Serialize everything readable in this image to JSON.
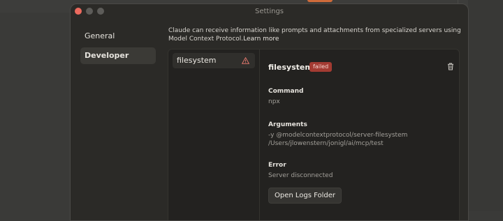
{
  "window": {
    "title": "Settings",
    "controls": [
      "close",
      "minimize",
      "maximize"
    ]
  },
  "sidebar": {
    "items": [
      {
        "label": "General",
        "active": false
      },
      {
        "label": "Developer",
        "active": true
      }
    ]
  },
  "description": {
    "text": "Claude can receive information like prompts and attachments from specialized servers using Model Context Protocol.",
    "link": "Learn more"
  },
  "servers": [
    {
      "name": "filesystem",
      "status_icon": "warning-icon"
    }
  ],
  "detail": {
    "name": "filesystem",
    "status_badge": "failed",
    "command_label": "Command",
    "command_value": "npx",
    "arguments_label": "Arguments",
    "arguments_line1": "-y @modelcontextprotocol/server-filesystem",
    "arguments_line2": "/Users/jlowenstern/jonigl/ai/mcp/test",
    "error_label": "Error",
    "error_value": "Server disconnected",
    "open_logs_button": "Open Logs Folder",
    "delete_icon": "trash-icon"
  },
  "colors": {
    "accent_orange": "#cf6b3a",
    "failed_badge": "#a33b32",
    "window_bg": "#2b2a27",
    "close_light": "#ec6a5e"
  }
}
